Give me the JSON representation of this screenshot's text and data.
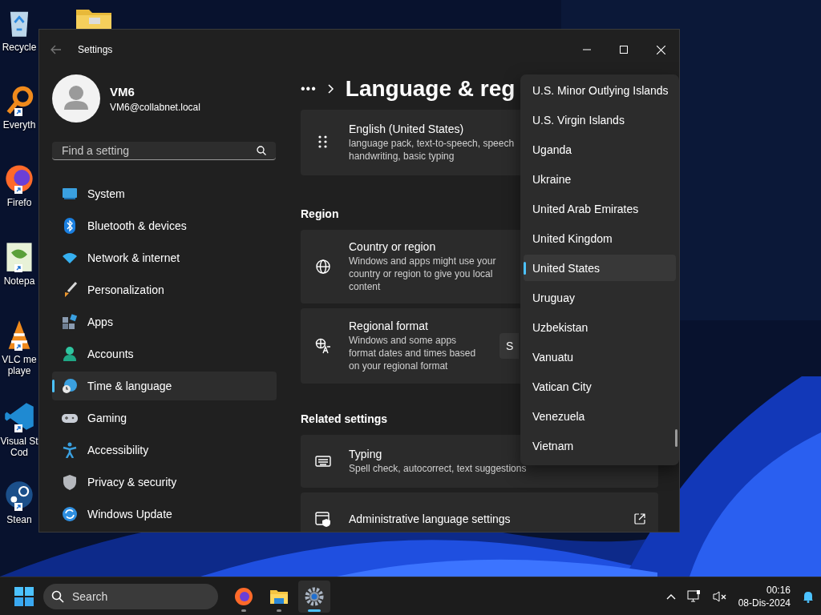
{
  "desktop_icons": [
    {
      "kind": "recycle",
      "label": "Recycle",
      "shortcut": false
    },
    {
      "kind": "search-app",
      "label": "Everyth",
      "shortcut": true
    },
    {
      "kind": "firefox",
      "label": "Firefo",
      "shortcut": true
    },
    {
      "kind": "notepad",
      "label": "Notepa",
      "shortcut": true
    },
    {
      "kind": "vlc",
      "label": "VLC me\nplaye",
      "shortcut": true
    },
    {
      "kind": "vscode",
      "label": "Visual St\nCod",
      "shortcut": true
    },
    {
      "kind": "steam",
      "label": "Stean",
      "shortcut": true
    }
  ],
  "window": {
    "title": "Settings"
  },
  "account": {
    "name": "VM6",
    "email": "VM6@collabnet.local"
  },
  "search": {
    "placeholder": "Find a setting"
  },
  "nav": [
    {
      "kind": "system",
      "label": "System",
      "selected": false
    },
    {
      "kind": "bluetooth",
      "label": "Bluetooth & devices",
      "selected": false
    },
    {
      "kind": "network",
      "label": "Network & internet",
      "selected": false
    },
    {
      "kind": "brush",
      "label": "Personalization",
      "selected": false
    },
    {
      "kind": "apps",
      "label": "Apps",
      "selected": false
    },
    {
      "kind": "accounts",
      "label": "Accounts",
      "selected": false
    },
    {
      "kind": "time",
      "label": "Time & language",
      "selected": true
    },
    {
      "kind": "gaming",
      "label": "Gaming",
      "selected": false
    },
    {
      "kind": "accessibility",
      "label": "Accessibility",
      "selected": false
    },
    {
      "kind": "privacy",
      "label": "Privacy & security",
      "selected": false
    },
    {
      "kind": "update",
      "label": "Windows Update",
      "selected": false
    }
  ],
  "header": {
    "breadcrumb": "•••",
    "title": "Language & reg"
  },
  "language": {
    "name": "English (United States)",
    "description": "language pack, text-to-speech, speech\nhandwriting, basic typing"
  },
  "region": {
    "heading": "Region",
    "cards": [
      {
        "kind": "globe",
        "title": "Country or region",
        "description": "Windows and apps might use your\ncountry or region to give you local\ncontent"
      },
      {
        "kind": "format",
        "title": "Regional format",
        "description": "Windows and some apps\nformat dates and times based\non your regional format",
        "button": "S"
      }
    ]
  },
  "related": {
    "heading": "Related settings",
    "cards": [
      {
        "kind": "keyboard",
        "title": "Typing",
        "description": "Spell check, autocorrect, text suggestions",
        "external": false
      },
      {
        "kind": "admin",
        "title": "Administrative language settings",
        "external": true
      }
    ]
  },
  "country_dropdown": {
    "items": [
      {
        "label": "U.S. Minor Outlying Islands",
        "selected": false
      },
      {
        "label": "U.S. Virgin Islands",
        "selected": false
      },
      {
        "label": "Uganda",
        "selected": false
      },
      {
        "label": "Ukraine",
        "selected": false
      },
      {
        "label": "United Arab Emirates",
        "selected": false
      },
      {
        "label": "United Kingdom",
        "selected": false
      },
      {
        "label": "United States",
        "selected": true
      },
      {
        "label": "Uruguay",
        "selected": false
      },
      {
        "label": "Uzbekistan",
        "selected": false
      },
      {
        "label": "Vanuatu",
        "selected": false
      },
      {
        "label": "Vatican City",
        "selected": false
      },
      {
        "label": "Venezuela",
        "selected": false
      },
      {
        "label": "Vietnam",
        "selected": false
      }
    ]
  },
  "taskbar": {
    "search_placeholder": "Search",
    "apps": [
      {
        "kind": "firefox",
        "active": false
      },
      {
        "kind": "explorer",
        "active": false
      },
      {
        "kind": "settings",
        "active": true
      }
    ],
    "time": "00:16",
    "date": "08-Dis-2024"
  }
}
